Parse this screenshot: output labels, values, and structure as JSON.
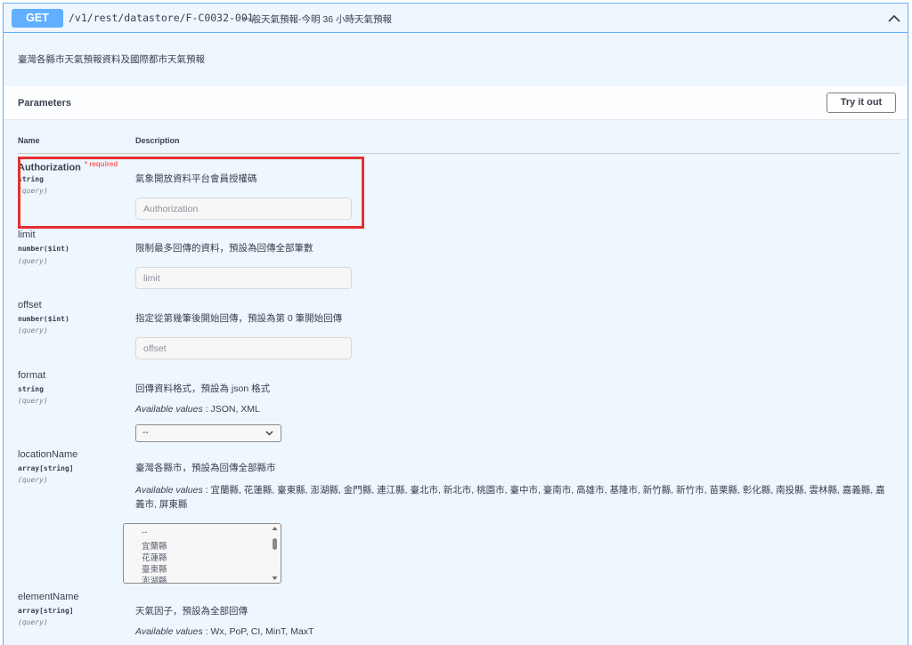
{
  "summary": {
    "method": "GET",
    "path": "/v1/rest/datastore/F-C0032-001",
    "description": "一般天氣預報-今明 36 小時天氣預報",
    "collapse_icon": "chevron-up-icon"
  },
  "operation_description": "臺灣各縣市天氣預報資料及國際都市天氣預報",
  "parameters_section": {
    "title": "Parameters",
    "try_button": "Try it out",
    "col_name": "Name",
    "col_description": "Description"
  },
  "params": [
    {
      "name": "Authorization",
      "required": "* required",
      "type": "string",
      "in": "(query)",
      "description": "氣象開放資料平台會員授權碼",
      "placeholder": "Authorization"
    },
    {
      "name": "limit",
      "type": "number($int)",
      "in": "(query)",
      "description": "限制最多回傳的資料，預設為回傳全部筆數",
      "placeholder": "limit"
    },
    {
      "name": "offset",
      "type": "number($int)",
      "in": "(query)",
      "description": "指定從第幾筆後開始回傳，預設為第 0 筆開始回傳",
      "placeholder": "offset"
    },
    {
      "name": "format",
      "type": "string",
      "in": "(query)",
      "description": "回傳資料格式，預設為 json 格式",
      "available_label": "Available values",
      "available_values": " : JSON, XML",
      "select_value": "--"
    },
    {
      "name": "locationName",
      "type": "array[string]",
      "in": "(query)",
      "description": "臺灣各縣市，預設為回傳全部縣市",
      "available_label": "Available values",
      "available_values": " : 宜蘭縣, 花蓮縣, 臺東縣, 澎湖縣, 金門縣, 連江縣, 臺北市, 新北市, 桃園市, 臺中市, 臺南市, 高雄市, 基隆市, 新竹縣, 新竹市, 苗栗縣, 彰化縣, 南投縣, 雲林縣, 嘉義縣, 嘉義市, 屏東縣",
      "options": [
        "--",
        "宜蘭縣",
        "花蓮縣",
        "臺東縣",
        "澎湖縣"
      ]
    },
    {
      "name": "elementName",
      "type": "array[string]",
      "in": "(query)",
      "description": "天氣因子，預設為全部回傳",
      "available_label": "Available values",
      "available_values": " : Wx, PoP, CI, MinT, MaxT"
    }
  ],
  "colors": {
    "get_accent": "#61affe",
    "panel_bg": "#eef6fe",
    "required": "#ff6060",
    "highlight_box": "#e53030"
  }
}
